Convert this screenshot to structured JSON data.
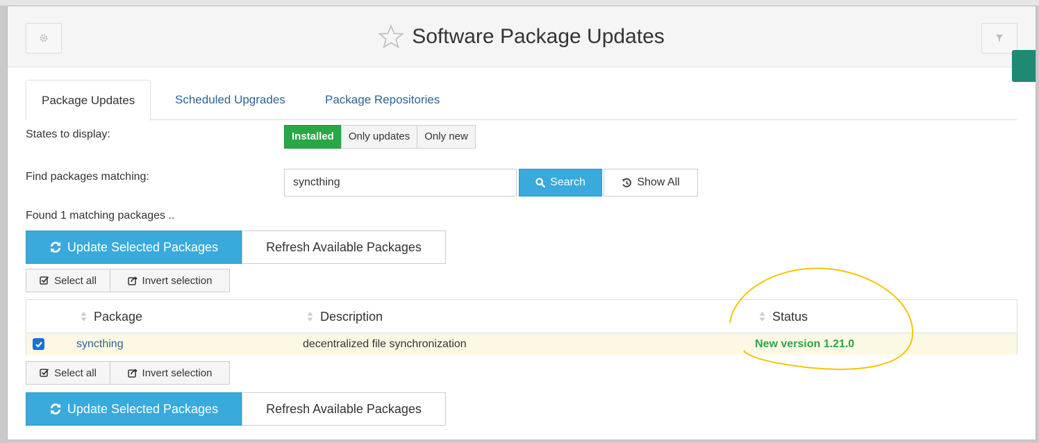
{
  "colors": {
    "accent_blue": "#3aa9dc",
    "installed_green": "#28a745",
    "link_blue": "#2a6496",
    "row_highlight": "#fcf8e3",
    "notify_tab": "#1e8a73",
    "annotation": "#f5c400"
  },
  "header": {
    "title": "Software Package Updates",
    "left_icon": "gear-icon",
    "right_icon": "filter-icon",
    "star_icon": "star-icon"
  },
  "tabs": [
    {
      "label": "Package Updates",
      "active": true
    },
    {
      "label": "Scheduled Upgrades",
      "active": false
    },
    {
      "label": "Package Repositories",
      "active": false
    }
  ],
  "filters": {
    "states_label": "States to display:",
    "states": [
      {
        "label": "Installed",
        "selected": true
      },
      {
        "label": "Only updates",
        "selected": false
      },
      {
        "label": "Only new",
        "selected": false
      }
    ],
    "find_label": "Find packages matching:",
    "search_value": "syncthing",
    "search_button": "Search",
    "show_all_button": "Show All"
  },
  "results": {
    "found_text": "Found 1 matching packages .."
  },
  "actions": {
    "update_selected": "Update Selected Packages",
    "refresh_available": "Refresh Available Packages",
    "select_all": "Select all",
    "invert_selection": "Invert selection"
  },
  "table": {
    "columns": [
      "Package",
      "Description",
      "Status"
    ],
    "rows": [
      {
        "checked": true,
        "package": "syncthing",
        "description": "decentralized file synchronization",
        "status": "New version 1.21.0"
      }
    ]
  }
}
